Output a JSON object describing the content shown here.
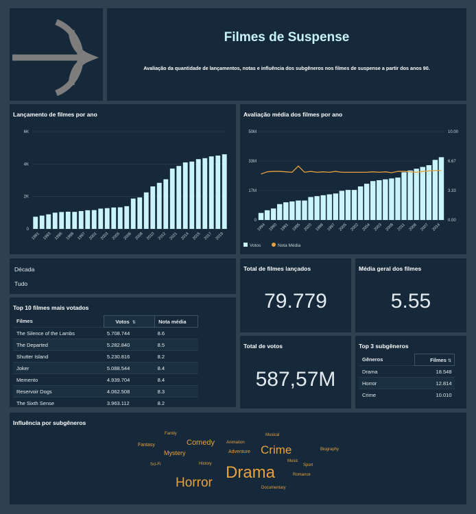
{
  "header": {
    "title": "Filmes de Suspense",
    "subtitle": "Avaliação da quantidade de lançamentos, notas e influência dos subgêneros nos filmes de suspense a partir dos anos 90."
  },
  "filter": {
    "label": "Década",
    "value": "Tudo"
  },
  "kpi": {
    "total_filmes_title": "Total de filmes lançados",
    "total_filmes_value": "79.779",
    "media_title": "Média geral dos filmes",
    "media_value": "5.55",
    "votos_title": "Total de votos",
    "votos_value": "587,57M"
  },
  "top10": {
    "title": "Top 10 filmes mais votados",
    "headers": [
      "Filmes",
      "Votos",
      "Nota média"
    ],
    "sort_icon": "sort-arrows-icon",
    "rows": [
      [
        "The Silence of the Lambs",
        "5.708.744",
        "8.6"
      ],
      [
        "The Departed",
        "5.282.840",
        "8.5"
      ],
      [
        "Shutter Island",
        "5.230.816",
        "8.2"
      ],
      [
        "Joker",
        "5.088.544",
        "8.4"
      ],
      [
        "Memento",
        "4.939.704",
        "8.4"
      ],
      [
        "Reservoir Dogs",
        "4.062.508",
        "8.3"
      ],
      [
        "The Sixth Sense",
        "3.963.112",
        "8.2"
      ]
    ]
  },
  "top3": {
    "title": "Top 3 subgêneros",
    "headers": [
      "Gêneros",
      "Filmes"
    ],
    "rows": [
      [
        "Drama",
        "18.548"
      ],
      [
        "Horror",
        "12.814"
      ],
      [
        "Crime",
        "10.010"
      ]
    ]
  },
  "wordcloud": {
    "title": "Influência por subgêneros",
    "color": "#e8a13c",
    "words": [
      {
        "text": "Family",
        "size": 6
      },
      {
        "text": "Fantasy",
        "size": 7
      },
      {
        "text": "Comedy",
        "size": 11
      },
      {
        "text": "Mystery",
        "size": 9
      },
      {
        "text": "Animation",
        "size": 6
      },
      {
        "text": "Adventure",
        "size": 7
      },
      {
        "text": "Musical",
        "size": 6
      },
      {
        "text": "Crime",
        "size": 17
      },
      {
        "text": "Biography",
        "size": 6
      },
      {
        "text": "Sci-Fi",
        "size": 6
      },
      {
        "text": "History",
        "size": 6
      },
      {
        "text": "Drama",
        "size": 24
      },
      {
        "text": "Music",
        "size": 6
      },
      {
        "text": "Sport",
        "size": 6
      },
      {
        "text": "Romance",
        "size": 6
      },
      {
        "text": "Horror",
        "size": 19
      },
      {
        "text": "Documentary",
        "size": 6
      }
    ]
  },
  "chart_data": [
    {
      "type": "bar",
      "title": "Lançamento de filmes por ano",
      "xlabel": "",
      "ylabel": "",
      "ylim": [
        0,
        6000
      ],
      "yticks": [
        "0",
        "2K",
        "4K",
        "6K"
      ],
      "grid": true,
      "bar_color": "#c9f4fc",
      "categories": [
        "1991",
        "1992",
        "1993",
        "1994",
        "1995",
        "1996",
        "1997",
        "1998",
        "1999",
        "2000",
        "2001",
        "2002",
        "2003",
        "2004",
        "2005",
        "2006",
        "2007",
        "2008",
        "2009",
        "2010",
        "2011",
        "2012",
        "2013",
        "2021",
        "2014",
        "2015",
        "2016",
        "2017",
        "2018",
        "2019"
      ],
      "tick_labels": [
        "1991",
        "1993",
        "1996",
        "1998",
        "1997",
        "2001",
        "2003",
        "2005",
        "2006",
        "2008",
        "2010",
        "2012",
        "2021",
        "2014",
        "2015",
        "2017",
        "2019"
      ],
      "values": [
        750,
        820,
        900,
        1000,
        1040,
        1060,
        1050,
        1100,
        1150,
        1160,
        1250,
        1280,
        1320,
        1330,
        1400,
        1870,
        1940,
        2250,
        2620,
        2840,
        3060,
        3720,
        3880,
        4100,
        4150,
        4300,
        4360,
        4470,
        4520,
        4600
      ]
    },
    {
      "type": "bar",
      "title": "Avaliação média dos filmes por ano",
      "xlabel": "",
      "ylabel": "",
      "ylim": [
        0,
        50000000
      ],
      "y2lim": [
        0,
        10
      ],
      "yticks_left": [
        "0",
        "17M",
        "33M",
        "50M"
      ],
      "yticks_right": [
        "0.00",
        "3.33",
        "6.67",
        "10.00"
      ],
      "legend": [
        "Votos",
        "Nota Média"
      ],
      "legend_position": "bottom-left",
      "bar_color": "#c9f4fc",
      "line_color": "#e8a13c",
      "tick_labels": [
        "1994",
        "1990",
        "1991",
        "1995",
        "2020",
        "1996",
        "1997",
        "2005",
        "2002",
        "2004",
        "2003",
        "2008",
        "2011",
        "2006",
        "2007",
        "2014"
      ],
      "series": [
        {
          "name": "Votos",
          "values": [
            4000000,
            5500000,
            6500000,
            9000000,
            10000000,
            10500000,
            11000000,
            11000000,
            13000000,
            13500000,
            14000000,
            14500000,
            15000000,
            16500000,
            17000000,
            17000000,
            19000000,
            20500000,
            22000000,
            22500000,
            23000000,
            23500000,
            24000000,
            27000000,
            28000000,
            29000000,
            30000000,
            31000000,
            34000000,
            35500000
          ]
        },
        {
          "name": "Nota Média",
          "values": [
            5.2,
            5.45,
            5.5,
            5.5,
            5.45,
            5.4,
            6.1,
            5.4,
            5.5,
            5.4,
            5.45,
            5.4,
            5.5,
            5.4,
            5.4,
            5.4,
            5.4,
            5.4,
            5.45,
            5.4,
            5.45,
            5.35,
            5.5,
            5.5,
            5.45,
            5.4,
            5.5,
            5.55,
            5.6,
            5.6
          ]
        }
      ]
    }
  ]
}
